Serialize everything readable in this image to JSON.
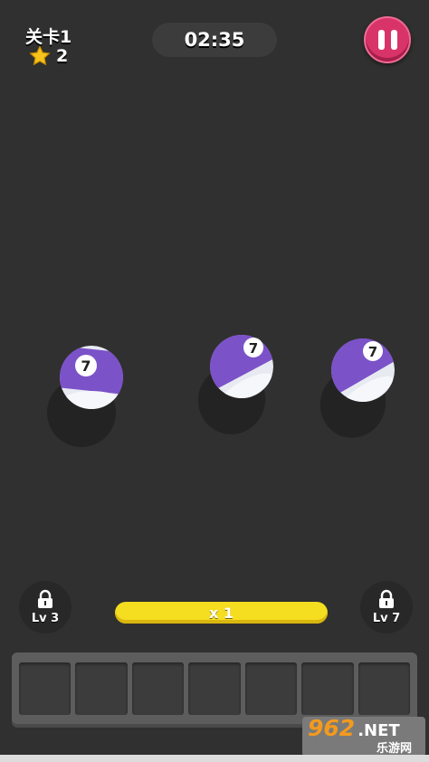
{
  "hud": {
    "level_label": "关卡1",
    "star_count": "2",
    "timer": "02:35"
  },
  "balls": [
    {
      "number": "7",
      "color": "#7b52c8"
    },
    {
      "number": "7",
      "color": "#7b52c8"
    },
    {
      "number": "7",
      "color": "#7b52c8"
    }
  ],
  "locks": {
    "left_label": "Lv 3",
    "right_label": "Lv 7"
  },
  "multiplier_label": "x 1",
  "tray": {
    "slot_count": 7
  },
  "watermark": {
    "number": "962",
    "suffix": ".NET",
    "subtitle": "乐游网"
  },
  "colors": {
    "background": "#303030",
    "pause_button": "#d8346a",
    "multiplier_bar": "#f5dd1f",
    "ball_stripe": "#7b52c8"
  }
}
